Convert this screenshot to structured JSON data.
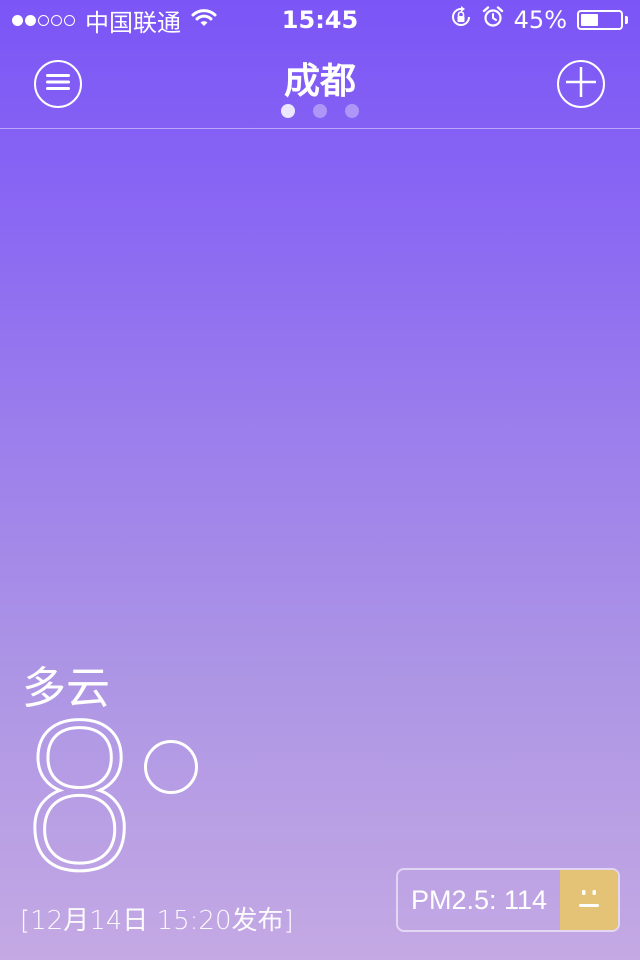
{
  "status_bar": {
    "carrier": "中国联通",
    "time": "15:45",
    "battery_text": "45%",
    "battery_level": 0.45,
    "signal_strength": 2,
    "signal_max": 5
  },
  "header": {
    "city": "成都",
    "pages": 3,
    "active_page": 0
  },
  "weather": {
    "condition": "多云",
    "temperature": "8",
    "published": "[12月14日 15:20发布]"
  },
  "pm25": {
    "label": "PM2.5: 114",
    "face_color": "#e4c276"
  },
  "colors": {
    "gradient_top": "#7b55f6",
    "gradient_bottom": "#c4a9e4"
  }
}
